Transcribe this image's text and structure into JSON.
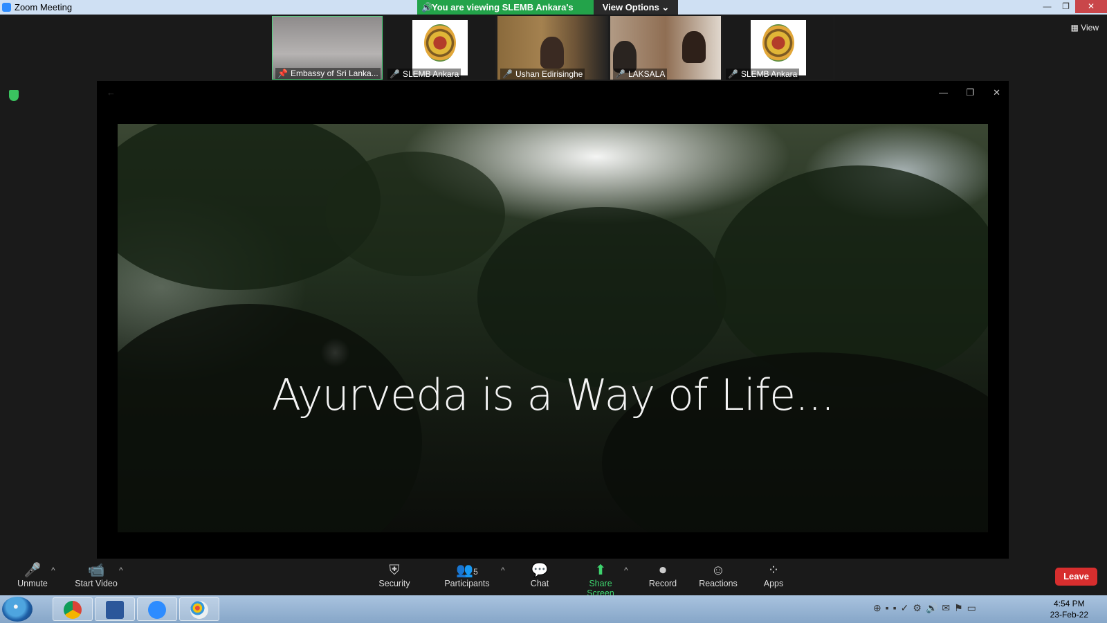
{
  "window": {
    "title": "Zoom Meeting",
    "controls": [
      "—",
      "❐",
      "✕"
    ]
  },
  "share_banner": {
    "text": "You are viewing SLEMB Ankara's screen",
    "options_label": "View Options ⌄"
  },
  "participants_strip": [
    {
      "name": "Embassy of Sri Lanka...",
      "muted": false,
      "pinned": true
    },
    {
      "name": "SLEMB Ankara",
      "muted": true
    },
    {
      "name": "Ushan Edirisinghe",
      "muted": true
    },
    {
      "name": "LAKSALA",
      "muted": true
    },
    {
      "name": "SLEMB Ankara",
      "muted": true
    }
  ],
  "view_button": "View",
  "shared_content": {
    "video_title": "Ayurveda is a Way of Life..."
  },
  "toolbar": {
    "unmute": "Unmute",
    "start_video": "Start Video",
    "security": "Security",
    "participants": "Participants",
    "participants_count": "5",
    "chat": "Chat",
    "share_screen": "Share Screen",
    "record": "Record",
    "reactions": "Reactions",
    "apps": "Apps",
    "leave": "Leave"
  },
  "taskbar": {
    "time": "4:54 PM",
    "date": "23-Feb-22"
  },
  "colors": {
    "accent_green": "#23a34a",
    "leave_red": "#d72e2e",
    "titlebar": "#cfe0f3"
  }
}
